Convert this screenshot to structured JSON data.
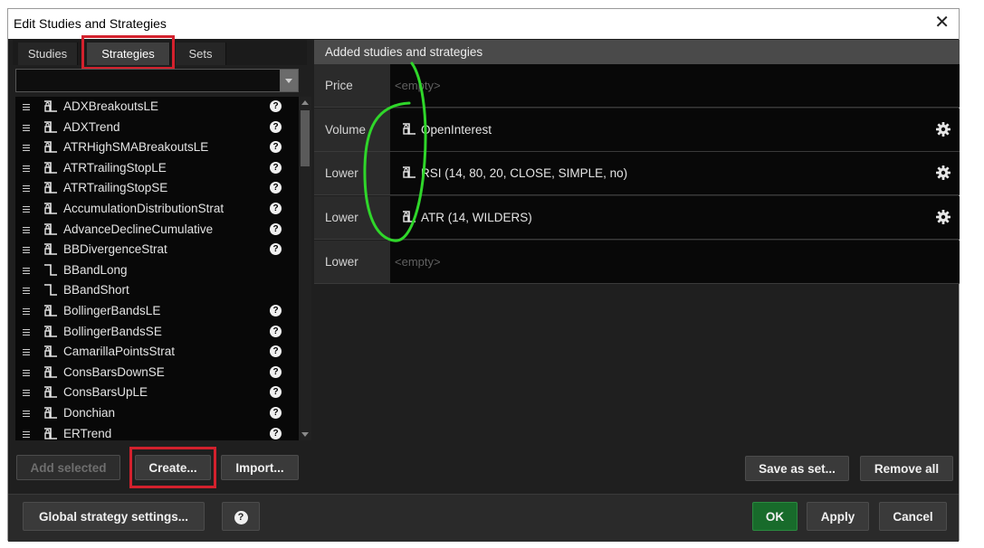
{
  "window": {
    "title": "Edit Studies and Strategies",
    "close_glyph": "✕"
  },
  "tabs": [
    {
      "label": "Studies"
    },
    {
      "label": "Strategies"
    },
    {
      "label": "Sets"
    }
  ],
  "search": {
    "value": "",
    "placeholder": ""
  },
  "strategies": [
    {
      "name": "ADXBreakoutsLE",
      "help": "?"
    },
    {
      "name": "ADXTrend",
      "help": "?"
    },
    {
      "name": "ATRHighSMABreakoutsLE",
      "help": "?"
    },
    {
      "name": "ATRTrailingStopLE",
      "help": "?"
    },
    {
      "name": "ATRTrailingStopSE",
      "help": "?"
    },
    {
      "name": "AccumulationDistributionStrat",
      "help": "?"
    },
    {
      "name": "AdvanceDeclineCumulative",
      "help": "?"
    },
    {
      "name": "BBDivergenceStrat",
      "help": "?"
    },
    {
      "name": "BBandLong",
      "help": ""
    },
    {
      "name": "BBandShort",
      "help": ""
    },
    {
      "name": "BollingerBandsLE",
      "help": "?"
    },
    {
      "name": "BollingerBandsSE",
      "help": "?"
    },
    {
      "name": "CamarillaPointsStrat",
      "help": "?"
    },
    {
      "name": "ConsBarsDownSE",
      "help": "?"
    },
    {
      "name": "ConsBarsUpLE",
      "help": "?"
    },
    {
      "name": "Donchian",
      "help": "?"
    },
    {
      "name": "ERTrend",
      "help": "?"
    }
  ],
  "left_buttons": {
    "add_selected": "Add selected",
    "create": "Create...",
    "import": "Import..."
  },
  "added": {
    "header": "Added studies and strategies",
    "slots": [
      {
        "label": "Price",
        "empty": "<empty>",
        "study": ""
      },
      {
        "label": "Volume",
        "empty": "",
        "study": "OpenInterest"
      },
      {
        "label": "Lower",
        "empty": "",
        "study": "RSI (14, 80, 20, CLOSE, SIMPLE, no)"
      },
      {
        "label": "Lower",
        "empty": "",
        "study": "ATR (14, WILDERS)"
      },
      {
        "label": "Lower",
        "empty": "<empty>",
        "study": ""
      }
    ]
  },
  "right_buttons": {
    "save_as_set": "Save as set...",
    "remove_all": "Remove all"
  },
  "footer": {
    "global_settings": "Global strategy settings...",
    "help": "?",
    "ok": "OK",
    "apply": "Apply",
    "cancel": "Cancel"
  },
  "icons": {
    "strategy": "strategy-icon",
    "help": "help-icon",
    "gear": "gear-icon",
    "menu": "drag-handle-icon",
    "dropdown": "chevron-down-icon",
    "close": "close-icon"
  },
  "colors": {
    "highlight_box": "#d3212d",
    "annotation_stroke": "#2fd62a",
    "ok_button": "#186b2b"
  }
}
